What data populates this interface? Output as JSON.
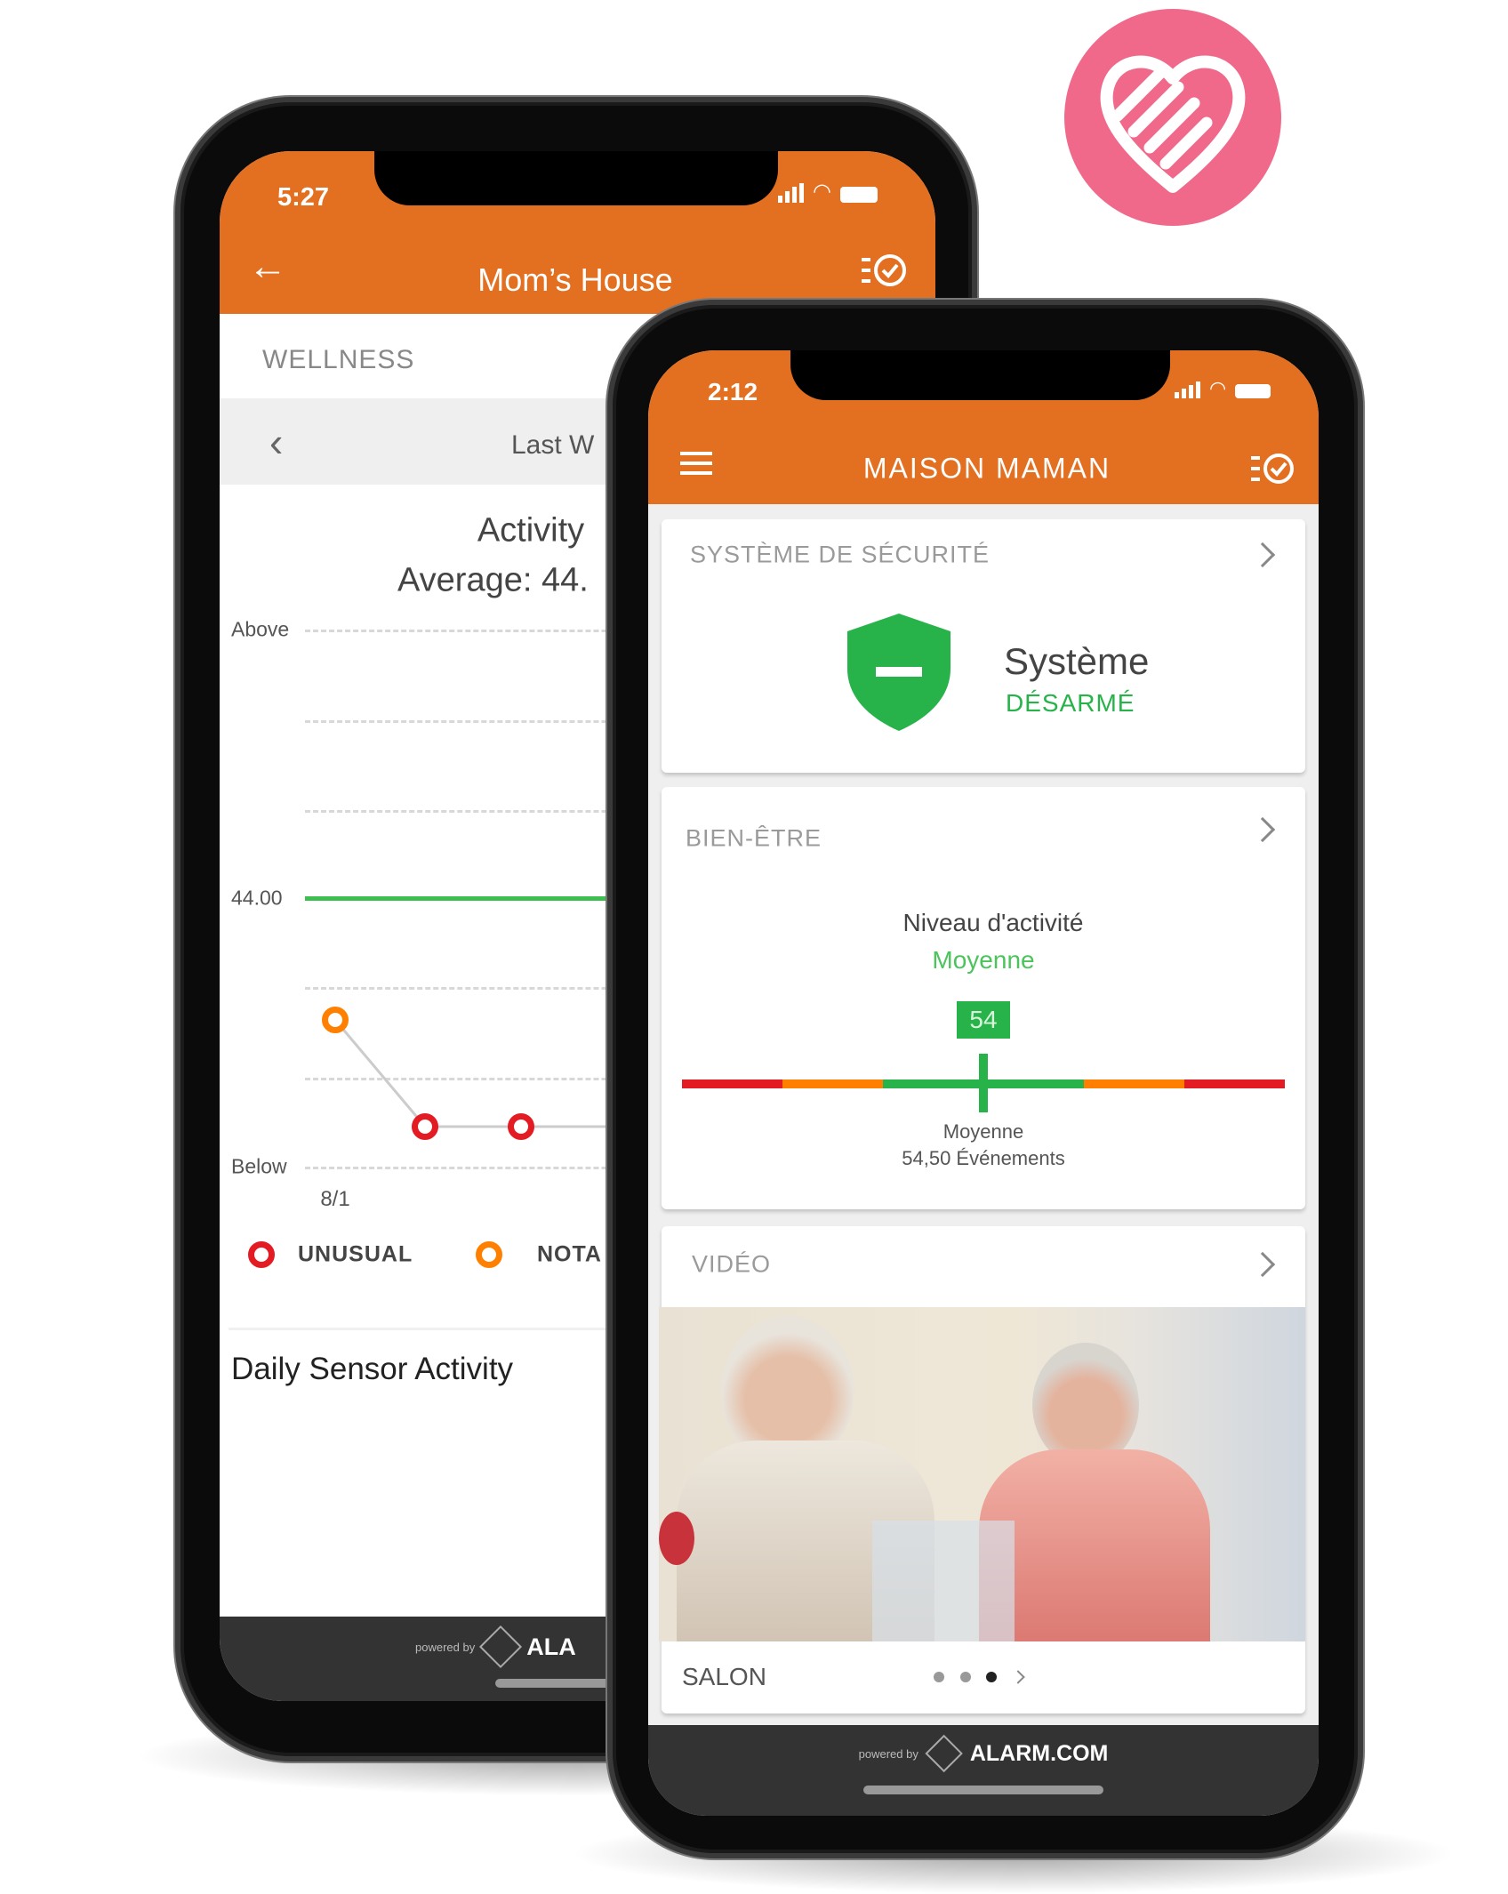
{
  "brand_colors": {
    "orange": "#e37020",
    "green": "#27b34a",
    "red": "#e31b23",
    "amber": "#ff8000",
    "pink": "#f0698a"
  },
  "logo": {
    "icon": "heart-hand-icon"
  },
  "back_phone": {
    "status": {
      "time": "5:27"
    },
    "header": {
      "title": "Mom’s House",
      "back_icon": "arrow-left-icon",
      "action_icon": "list-check-icon"
    },
    "section_label": "WELLNESS",
    "range_nav": {
      "label": "Last W",
      "prev_icon": "chevron-left-icon"
    },
    "chart_title": "Activity",
    "chart_subtitle": "Average: 44.",
    "chart_data": {
      "type": "line",
      "y_labels": [
        "Above",
        "44.00",
        "Below"
      ],
      "average": 44.0,
      "x_tick": "8/1",
      "points": [
        {
          "x": "8/1",
          "status": "notable"
        },
        {
          "status": "unusual"
        },
        {
          "status": "unusual"
        }
      ],
      "legend": [
        {
          "label": "UNUSUAL",
          "color": "#e31b23"
        },
        {
          "label": "NOTA",
          "color": "#ff8000"
        }
      ]
    },
    "section2_title": "Daily Sensor Activity",
    "footer": {
      "powered_by": "powered by",
      "brand": "ALA"
    }
  },
  "front_phone": {
    "status": {
      "time": "2:12"
    },
    "header": {
      "title": "MAISON MAMAN",
      "menu_icon": "hamburger-icon",
      "action_icon": "list-check-icon"
    },
    "security_card": {
      "title": "SYSTÈME DE SÉCURITÉ",
      "system_label": "Système",
      "state": "DÉSARMÉ",
      "icon": "shield-disarmed-icon"
    },
    "wellness_card": {
      "title": "BIEN-ÊTRE",
      "activity_label": "Niveau d'activité",
      "activity_level": "Moyenne",
      "value": "54",
      "gauge_fraction": 0.5,
      "scale_label": "Moyenne",
      "events": "54,50 Événements"
    },
    "video_card": {
      "title": "VIDÉO",
      "camera": "SALON",
      "page_count": 3,
      "active_page": 3
    },
    "footer": {
      "powered_by": "powered by",
      "brand": "ALARM.COM"
    }
  }
}
